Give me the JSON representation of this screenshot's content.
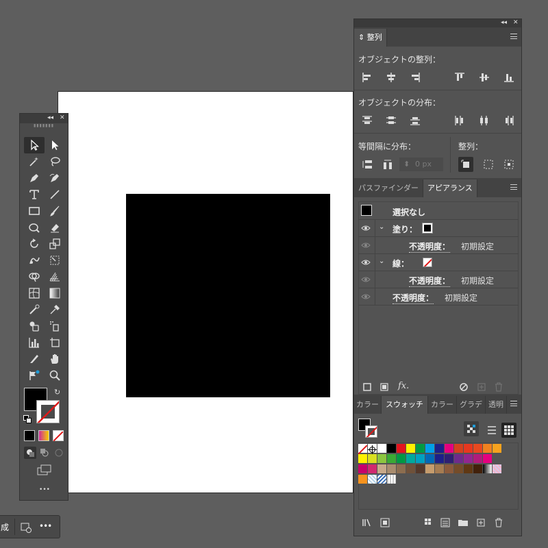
{
  "toolbar": {
    "collapse": "◂◂",
    "close": "✕",
    "more": "•••"
  },
  "align_panel": {
    "tab": "整列",
    "object_align_label": "オブジェクトの整列：",
    "object_distribute_label": "オブジェクトの分布：",
    "spacing_label": "等間隔に分布：",
    "align_to_label": "整列：",
    "spacing_value": "0 px"
  },
  "appearance_panel": {
    "tabs": [
      "パスファインダー",
      "アピアランス"
    ],
    "no_selection": "選択なし",
    "fill_label": "塗り：",
    "stroke_label": "線：",
    "opacity_label": "不透明度：",
    "opacity_value": "初期設定",
    "fx_label": "fx."
  },
  "swatch_panel": {
    "tabs": [
      "カラー",
      "スウォッチ",
      "カラー",
      "グラデ",
      "透明"
    ]
  },
  "bottombar": {
    "label": "成"
  },
  "colors": {
    "background": "#5e5e5e",
    "panel": "#535353",
    "toolbar": "#4a4a4a",
    "accent_blue": "#1e9bd7"
  }
}
